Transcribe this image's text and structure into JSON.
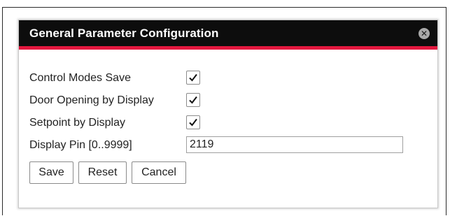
{
  "dialog": {
    "title": "General Parameter Configuration",
    "close_icon": "close-circle-icon"
  },
  "fields": [
    {
      "label": "Control Modes Save",
      "type": "checkbox",
      "checked": true
    },
    {
      "label": "Door Opening by Display",
      "type": "checkbox",
      "checked": true
    },
    {
      "label": "Setpoint by Display",
      "type": "checkbox",
      "checked": true
    },
    {
      "label": "Display Pin [0..9999]",
      "type": "text",
      "value": "2119"
    }
  ],
  "buttons": {
    "save_label": "Save",
    "reset_label": "Reset",
    "cancel_label": "Cancel"
  },
  "colors": {
    "titlebar_bg": "#0d0d0d",
    "accent_red": "#e3173e",
    "title_text": "#ffffff"
  }
}
